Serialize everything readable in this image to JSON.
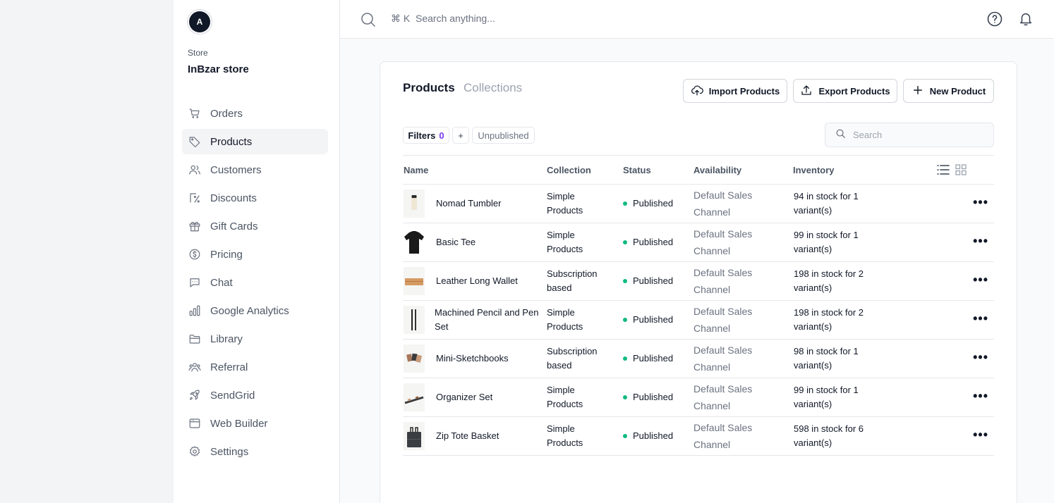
{
  "sidebar": {
    "avatar_letter": "A",
    "store_label": "Store",
    "store_name": "InBzar store",
    "items": [
      {
        "label": "Orders",
        "icon": "cart-icon",
        "active": false
      },
      {
        "label": "Products",
        "icon": "tag-icon",
        "active": true
      },
      {
        "label": "Customers",
        "icon": "users-icon",
        "active": false
      },
      {
        "label": "Discounts",
        "icon": "discount-icon",
        "active": false
      },
      {
        "label": "Gift Cards",
        "icon": "gift-icon",
        "active": false
      },
      {
        "label": "Pricing",
        "icon": "dollar-icon",
        "active": false
      },
      {
        "label": "Chat",
        "icon": "chat-icon",
        "active": false
      },
      {
        "label": "Google Analytics",
        "icon": "chart-icon",
        "active": false
      },
      {
        "label": "Library",
        "icon": "folder-icon",
        "active": false
      },
      {
        "label": "Referral",
        "icon": "referral-icon",
        "active": false
      },
      {
        "label": "SendGrid",
        "icon": "rocket-icon",
        "active": false
      },
      {
        "label": "Web Builder",
        "icon": "browser-icon",
        "active": false
      },
      {
        "label": "Settings",
        "icon": "gear-icon",
        "active": false
      }
    ]
  },
  "topbar": {
    "shortcut": "⌘ K",
    "search_placeholder": "Search anything..."
  },
  "main": {
    "tabs": {
      "products": "Products",
      "collections": "Collections"
    },
    "buttons": {
      "import": "Import Products",
      "export": "Export Products",
      "new": "New Product"
    },
    "filters": {
      "label": "Filters",
      "count": "0",
      "plus": "+",
      "unpublished": "Unpublished"
    },
    "search_placeholder": "Search",
    "columns": {
      "name": "Name",
      "collection": "Collection",
      "status": "Status",
      "availability": "Availability",
      "inventory": "Inventory"
    },
    "products": [
      {
        "name": "Nomad Tumbler",
        "collection": "Simple Products",
        "status": "Published",
        "availability": "Default Sales Channel",
        "inventory": "94 in stock for 1 variant(s)",
        "thumb": "tumbler"
      },
      {
        "name": "Basic Tee",
        "collection": "Simple Products",
        "status": "Published",
        "availability": "Default Sales Channel",
        "inventory": "99 in stock for 1 variant(s)",
        "thumb": "tee"
      },
      {
        "name": "Leather Long Wallet",
        "collection": "Subscription based",
        "status": "Published",
        "availability": "Default Sales Channel",
        "inventory": "198 in stock for 2 variant(s)",
        "thumb": "wallet"
      },
      {
        "name": "Machined Pencil and Pen Set",
        "collection": "Simple Products",
        "status": "Published",
        "availability": "Default Sales Channel",
        "inventory": "198 in stock for 2 variant(s)",
        "thumb": "pens"
      },
      {
        "name": "Mini-Sketchbooks",
        "collection": "Subscription based",
        "status": "Published",
        "availability": "Default Sales Channel",
        "inventory": "98 in stock for 1 variant(s)",
        "thumb": "sketchbooks"
      },
      {
        "name": "Organizer Set",
        "collection": "Simple Products",
        "status": "Published",
        "availability": "Default Sales Channel",
        "inventory": "99 in stock for 1 variant(s)",
        "thumb": "organizer"
      },
      {
        "name": "Zip Tote Basket",
        "collection": "Simple Products",
        "status": "Published",
        "availability": "Default Sales Channel",
        "inventory": "598 in stock for 6 variant(s)",
        "thumb": "tote"
      }
    ]
  },
  "colors": {
    "status_published": "#10b981",
    "filter_count": "#7c3aed"
  }
}
